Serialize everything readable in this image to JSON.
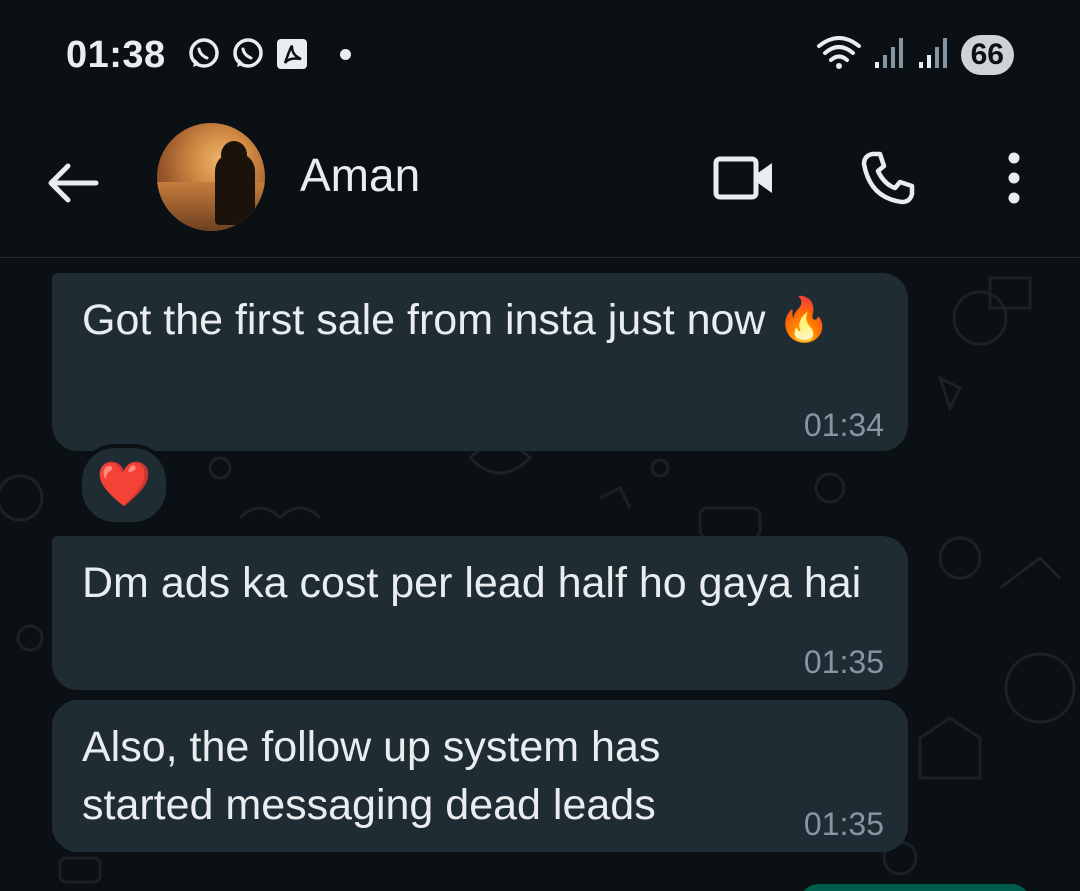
{
  "status_bar": {
    "time": "01:38",
    "left_icons": [
      "whatsapp-icon",
      "whatsapp-icon",
      "pdf-icon",
      "notification-dot"
    ],
    "right_icons": [
      "wifi-icon",
      "signal-icon",
      "signal-icon"
    ],
    "battery": "66"
  },
  "header": {
    "contact_name": "Aman",
    "icons": [
      "back-arrow-icon",
      "avatar",
      "video-call-icon",
      "phone-icon",
      "more-options-icon"
    ]
  },
  "messages": [
    {
      "text": "Got the first sale from insta just now 🔥",
      "time": "01:34",
      "reaction": "❤️"
    },
    {
      "text": "Dm ads ka cost per lead half ho gaya hai",
      "time": "01:35"
    },
    {
      "text": "Also, the follow up system has started messaging dead leads",
      "time": "01:35"
    }
  ],
  "colors": {
    "background": "#0b1014",
    "bubble": "#202c33",
    "text": "#e9edef",
    "timestamp": "#8696a0",
    "outgoing": "#005c4b"
  }
}
